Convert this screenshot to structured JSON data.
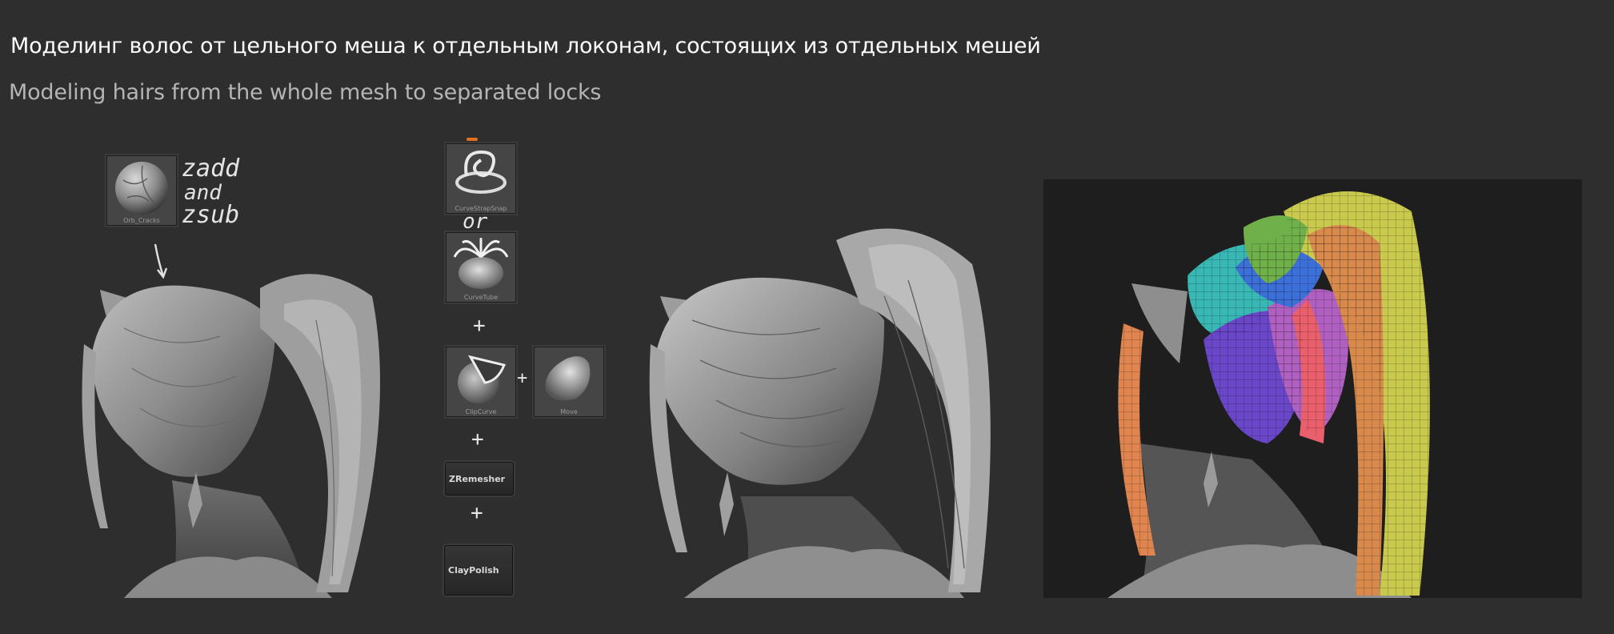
{
  "title_ru": "Моделинг волос от цельного меша к отдельным локонам, состоящих из отдельных мешей",
  "title_en": "Modeling hairs from the whole mesh to separated locks",
  "handwriting": {
    "zadd": "zadd",
    "and": "and",
    "zsub": "zsub",
    "or": "or",
    "plus": "+"
  },
  "brushes": {
    "orb_cracks": "Orb_Cracks",
    "curve_strap_snap": "CurveStrapSnap",
    "curve_tube": "CurveTube",
    "clip_curve": "ClipCurve",
    "move": "Move"
  },
  "buttons": {
    "zremesher": "ZRemesher",
    "claypolish": "ClayPolish"
  },
  "colors": {
    "background": "#2e2e2e",
    "render_panel": "#1e1e1e",
    "title": "#ffffff",
    "subtitle": "#b5b5b5"
  }
}
